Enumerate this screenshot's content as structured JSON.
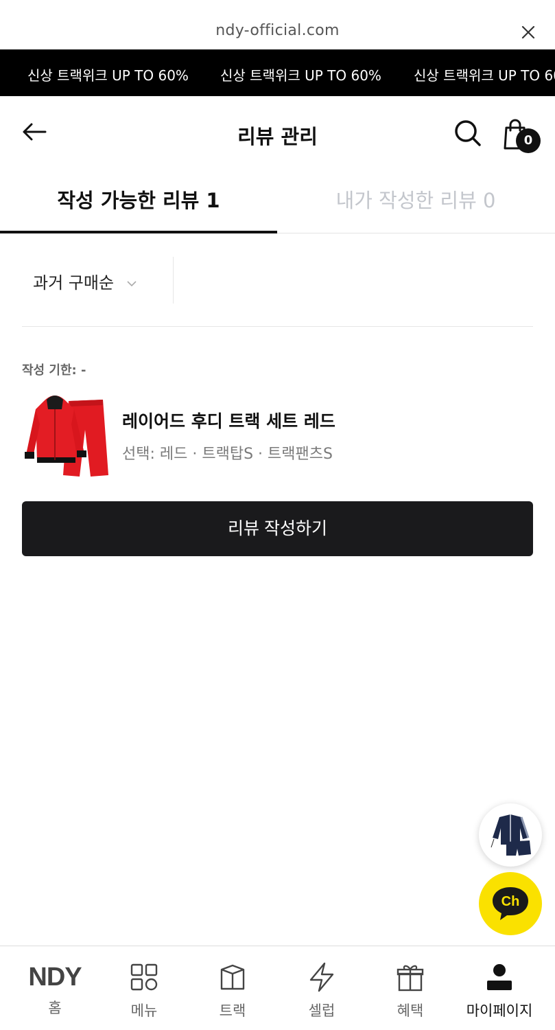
{
  "browser": {
    "url": "ndy-official.com"
  },
  "marquee": {
    "items": [
      "신상 트랙위크 UP TO 60%",
      "신상 트랙위크 UP TO 60%",
      "신상 트랙위크 UP TO 60%"
    ]
  },
  "header": {
    "title": "리뷰 관리",
    "cart_count": "0"
  },
  "tabs": [
    {
      "label": "작성 가능한 리뷰 1",
      "active": true
    },
    {
      "label": "내가 작성한 리뷰 0",
      "active": false
    }
  ],
  "filter": {
    "sort_label": "과거 구매순"
  },
  "review_item": {
    "deadline": "작성 기한: -",
    "product_name": "레이어드 후디 트랙 세트 레드",
    "option": "선택: 레드 · 트랙탑S · 트랙팬츠S",
    "write_label": "리뷰 작성하기"
  },
  "bottom_nav": [
    {
      "label": "홈",
      "icon": "ndy-logo",
      "logo_text": "NDY"
    },
    {
      "label": "메뉴",
      "icon": "grid-icon"
    },
    {
      "label": "트랙",
      "icon": "box-icon"
    },
    {
      "label": "셀럽",
      "icon": "lightning-icon"
    },
    {
      "label": "혜택",
      "icon": "gift-icon"
    },
    {
      "label": "마이페이지",
      "icon": "person-icon",
      "active": true
    }
  ],
  "colors": {
    "marquee_bg": "#000000",
    "button_bg": "#1a1a1c",
    "chat_bg": "#fae100",
    "inactive_tab": "#c3c6cc"
  }
}
